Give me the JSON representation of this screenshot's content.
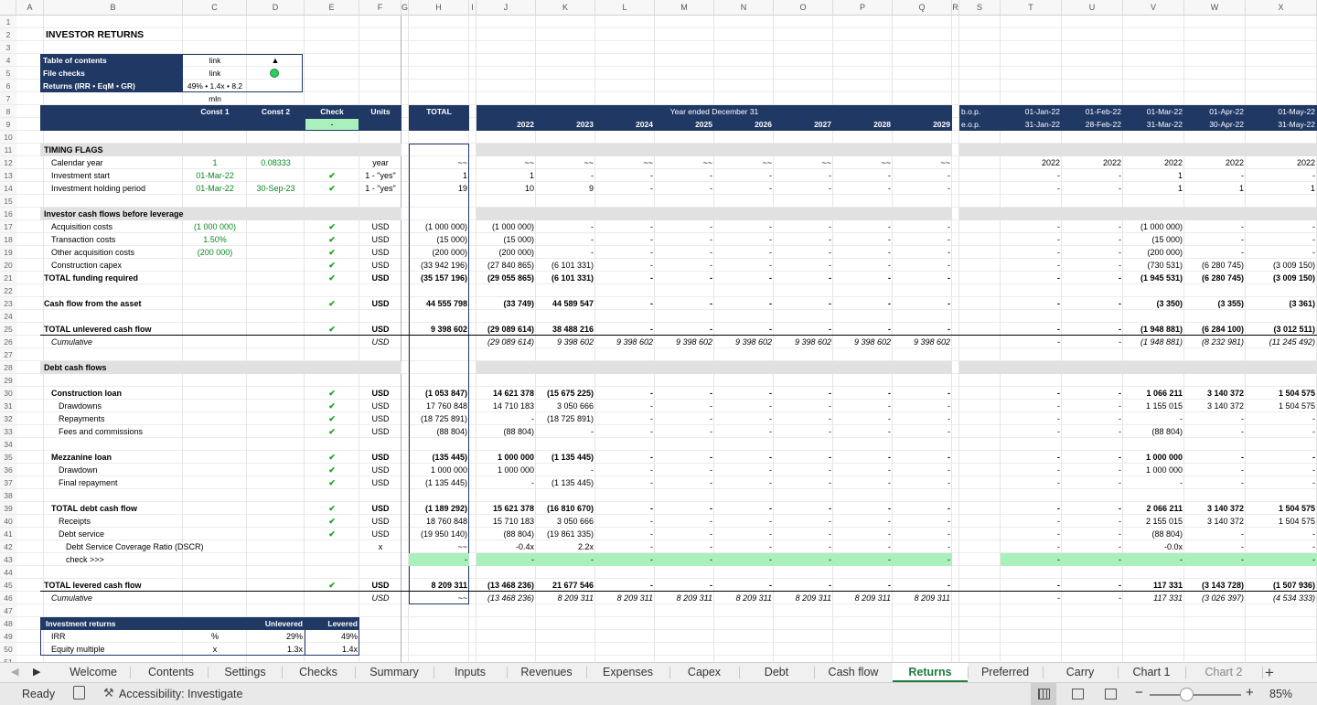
{
  "columns": [
    "A",
    "B",
    "C",
    "D",
    "E",
    "F",
    "G",
    "H",
    "I",
    "J",
    "K",
    "L",
    "M",
    "N",
    "O",
    "P",
    "Q",
    "R",
    "S",
    "T",
    "U",
    "V",
    "W",
    "X"
  ],
  "title": "INVESTOR RETURNS",
  "toc": {
    "r1": "Table of contents",
    "r1v": "link",
    "r1i": "▲",
    "r2": "File checks",
    "r2v": "link",
    "r3": "Returns (IRR • EqM • GR)",
    "r3v": "49% • 1.4x • 8.2 mln"
  },
  "header": {
    "const1": "Const 1",
    "const2": "Const 2",
    "check": "Check",
    "units": "Units",
    "total": "TOTAL",
    "check_val": "-",
    "year_ended": "Year ended December 31",
    "years": [
      "2022",
      "2023",
      "2024",
      "2025",
      "2026",
      "2027",
      "2028",
      "2029"
    ],
    "bop": "b.o.p.",
    "eop": "e.o.p.",
    "bop_dates": [
      "01-Jan-22",
      "01-Feb-22",
      "01-Mar-22",
      "01-Apr-22",
      "01-May-22"
    ],
    "eop_dates": [
      "31-Jan-22",
      "28-Feb-22",
      "31-Mar-22",
      "30-Apr-22",
      "31-May-22"
    ]
  },
  "rows": [
    {
      "r": 11,
      "b": "TIMING FLAGS",
      "bold": true,
      "band": true
    },
    {
      "r": 12,
      "b": "Calendar year",
      "ind": 1,
      "c": "1",
      "d": "0.08333",
      "f": "year",
      "h": "~~",
      "y": [
        "~~",
        "~~",
        "~~",
        "~~",
        "~~",
        "~~",
        "~~",
        "~~"
      ],
      "m": [
        "2022",
        "2022",
        "2022",
        "2022",
        "2022"
      ]
    },
    {
      "r": 13,
      "b": "Investment start",
      "ind": 1,
      "c": "01-Mar-22",
      "e": "✔",
      "f": "1 - \"yes\"",
      "h": "1",
      "y": [
        "1",
        "-",
        "-",
        "-",
        "-",
        "-",
        "-",
        "-"
      ],
      "m": [
        "-",
        "-",
        "1",
        "-",
        "-"
      ]
    },
    {
      "r": 14,
      "b": "Investment holding period",
      "ind": 1,
      "c": "01-Mar-22",
      "d": "30-Sep-23",
      "e": "✔",
      "f": "1 - \"yes\"",
      "h": "19",
      "y": [
        "10",
        "9",
        "-",
        "-",
        "-",
        "-",
        "-",
        "-"
      ],
      "m": [
        "-",
        "-",
        "1",
        "1",
        "1"
      ]
    },
    {
      "r": 16,
      "b": "Investor cash flows before leverage",
      "bold": true,
      "band": true
    },
    {
      "r": 17,
      "b": "Acquisition costs",
      "ind": 1,
      "c": "(1 000 000)",
      "e": "✔",
      "f": "USD",
      "h": "(1 000 000)",
      "y": [
        "(1 000 000)",
        "-",
        "-",
        "-",
        "-",
        "-",
        "-",
        "-"
      ],
      "m": [
        "-",
        "-",
        "(1 000 000)",
        "-",
        "-"
      ]
    },
    {
      "r": 18,
      "b": "Transaction costs",
      "ind": 1,
      "c": "1.50%",
      "e": "✔",
      "f": "USD",
      "h": "(15 000)",
      "y": [
        "(15 000)",
        "-",
        "-",
        "-",
        "-",
        "-",
        "-",
        "-"
      ],
      "m": [
        "-",
        "-",
        "(15 000)",
        "-",
        "-"
      ]
    },
    {
      "r": 19,
      "b": "Other acquisition costs",
      "ind": 1,
      "c": "(200 000)",
      "e": "✔",
      "f": "USD",
      "h": "(200 000)",
      "y": [
        "(200 000)",
        "-",
        "-",
        "-",
        "-",
        "-",
        "-",
        "-"
      ],
      "m": [
        "-",
        "-",
        "(200 000)",
        "-",
        "-"
      ]
    },
    {
      "r": 20,
      "b": "Construction capex",
      "ind": 1,
      "e": "✔",
      "f": "USD",
      "h": "(33 942 196)",
      "y": [
        "(27 840 865)",
        "(6 101 331)",
        "-",
        "-",
        "-",
        "-",
        "-",
        "-"
      ],
      "m": [
        "-",
        "-",
        "(730 531)",
        "(6 280 745)",
        "(3 009 150)"
      ]
    },
    {
      "r": 21,
      "b": "TOTAL funding required",
      "bold": true,
      "e": "✔",
      "f": "USD",
      "h": "(35 157 196)",
      "y": [
        "(29 055 865)",
        "(6 101 331)",
        "-",
        "-",
        "-",
        "-",
        "-",
        "-"
      ],
      "m": [
        "-",
        "-",
        "(1 945 531)",
        "(6 280 745)",
        "(3 009 150)"
      ]
    },
    {
      "r": 23,
      "b": "Cash flow from the asset",
      "bold": true,
      "e": "✔",
      "f": "USD",
      "h": "44 555 798",
      "y": [
        "(33 749)",
        "44 589 547",
        "-",
        "-",
        "-",
        "-",
        "-",
        "-"
      ],
      "m": [
        "-",
        "-",
        "(3 350)",
        "(3 355)",
        "(3 361)"
      ]
    },
    {
      "r": 25,
      "b": "TOTAL unlevered cash flow",
      "bold": true,
      "e": "✔",
      "f": "USD",
      "h": "9 398 602",
      "y": [
        "(29 089 614)",
        "38 488 216",
        "-",
        "-",
        "-",
        "-",
        "-",
        "-"
      ],
      "m": [
        "-",
        "-",
        "(1 948 881)",
        "(6 284 100)",
        "(3 012 511)"
      ],
      "topline": true
    },
    {
      "r": 26,
      "b": "Cumulative",
      "ital": true,
      "ind": 1,
      "f": "USD",
      "h": "",
      "y": [
        "(29 089 614)",
        "9 398 602",
        "9 398 602",
        "9 398 602",
        "9 398 602",
        "9 398 602",
        "9 398 602",
        "9 398 602"
      ],
      "m": [
        "-",
        "-",
        "(1 948 881)",
        "(8 232 981)",
        "(11 245 492)"
      ]
    },
    {
      "r": 28,
      "b": "Debt cash flows",
      "bold": true,
      "band": true
    },
    {
      "r": 30,
      "b": "Construction loan",
      "bold": true,
      "ind": 1,
      "e": "✔",
      "f": "USD",
      "h": "(1 053 847)",
      "y": [
        "14 621 378",
        "(15 675 225)",
        "-",
        "-",
        "-",
        "-",
        "-",
        "-"
      ],
      "m": [
        "-",
        "-",
        "1 066 211",
        "3 140 372",
        "1 504 575"
      ]
    },
    {
      "r": 31,
      "b": "Drawdowns",
      "ind": 2,
      "e": "✔",
      "f": "USD",
      "h": "17 760 848",
      "y": [
        "14 710 183",
        "3 050 666",
        "-",
        "-",
        "-",
        "-",
        "-",
        "-"
      ],
      "m": [
        "-",
        "-",
        "1 155 015",
        "3 140 372",
        "1 504 575"
      ]
    },
    {
      "r": 32,
      "b": "Repayments",
      "ind": 2,
      "e": "✔",
      "f": "USD",
      "h": "(18 725 891)",
      "y": [
        "-",
        "(18 725 891)",
        "-",
        "-",
        "-",
        "-",
        "-",
        "-"
      ],
      "m": [
        "-",
        "-",
        "-",
        "-",
        "-"
      ]
    },
    {
      "r": 33,
      "b": "Fees and commissions",
      "ind": 2,
      "e": "✔",
      "f": "USD",
      "h": "(88 804)",
      "y": [
        "(88 804)",
        "-",
        "-",
        "-",
        "-",
        "-",
        "-",
        "-"
      ],
      "m": [
        "-",
        "-",
        "(88 804)",
        "-",
        "-"
      ]
    },
    {
      "r": 35,
      "b": "Mezzanine loan",
      "bold": true,
      "ind": 1,
      "e": "✔",
      "f": "USD",
      "h": "(135 445)",
      "y": [
        "1 000 000",
        "(1 135 445)",
        "-",
        "-",
        "-",
        "-",
        "-",
        "-"
      ],
      "m": [
        "-",
        "-",
        "1 000 000",
        "-",
        "-"
      ]
    },
    {
      "r": 36,
      "b": "Drawdown",
      "ind": 2,
      "e": "✔",
      "f": "USD",
      "h": "1 000 000",
      "y": [
        "1 000 000",
        "-",
        "-",
        "-",
        "-",
        "-",
        "-",
        "-"
      ],
      "m": [
        "-",
        "-",
        "1 000 000",
        "-",
        "-"
      ]
    },
    {
      "r": 37,
      "b": "Final repayment",
      "ind": 2,
      "e": "✔",
      "f": "USD",
      "h": "(1 135 445)",
      "y": [
        "-",
        "(1 135 445)",
        "-",
        "-",
        "-",
        "-",
        "-",
        "-"
      ],
      "m": [
        "-",
        "-",
        "-",
        "-",
        "-"
      ]
    },
    {
      "r": 39,
      "b": "TOTAL debt cash flow",
      "bold": true,
      "ind": 1,
      "e": "✔",
      "f": "USD",
      "h": "(1 189 292)",
      "y": [
        "15 621 378",
        "(16 810 670)",
        "-",
        "-",
        "-",
        "-",
        "-",
        "-"
      ],
      "m": [
        "-",
        "-",
        "2 066 211",
        "3 140 372",
        "1 504 575"
      ]
    },
    {
      "r": 40,
      "b": "Receipts",
      "ind": 2,
      "e": "✔",
      "f": "USD",
      "h": "18 760 848",
      "y": [
        "15 710 183",
        "3 050 666",
        "-",
        "-",
        "-",
        "-",
        "-",
        "-"
      ],
      "m": [
        "-",
        "-",
        "2 155 015",
        "3 140 372",
        "1 504 575"
      ]
    },
    {
      "r": 41,
      "b": "Debt service",
      "ind": 2,
      "e": "✔",
      "f": "USD",
      "h": "(19 950 140)",
      "y": [
        "(88 804)",
        "(19 861 335)",
        "-",
        "-",
        "-",
        "-",
        "-",
        "-"
      ],
      "m": [
        "-",
        "-",
        "(88 804)",
        "-",
        "-"
      ]
    },
    {
      "r": 42,
      "b": "Debt Service Coverage Ratio (DSCR)",
      "ind": 3,
      "f": "x",
      "h": "~~",
      "y": [
        "-0.4x",
        "2.2x",
        "-",
        "-",
        "-",
        "-",
        "-",
        "-"
      ],
      "m": [
        "-",
        "-",
        "-0.0x",
        "-",
        "-"
      ]
    },
    {
      "r": 43,
      "b": "check >>>",
      "ind": 3,
      "h": "-",
      "y": [
        "-",
        "-",
        "-",
        "-",
        "-",
        "-",
        "-",
        "-"
      ],
      "m": [
        "-",
        "-",
        "-",
        "-",
        "-"
      ],
      "greenband": true
    },
    {
      "r": 45,
      "b": "TOTAL levered cash flow",
      "bold": true,
      "e": "✔",
      "f": "USD",
      "h": "8 209 311",
      "y": [
        "(13 468 236)",
        "21 677 546",
        "-",
        "-",
        "-",
        "-",
        "-",
        "-"
      ],
      "m": [
        "-",
        "-",
        "117 331",
        "(3 143 728)",
        "(1 507 936)"
      ],
      "topline": true
    },
    {
      "r": 46,
      "b": "Cumulative",
      "ital": true,
      "ind": 1,
      "f": "USD",
      "h": "~~",
      "y": [
        "(13 468 236)",
        "8 209 311",
        "8 209 311",
        "8 209 311",
        "8 209 311",
        "8 209 311",
        "8 209 311",
        "8 209 311"
      ],
      "m": [
        "-",
        "-",
        "117 331",
        "(3 026 397)",
        "(4 534 333)"
      ]
    }
  ],
  "returns": {
    "title": "Investment returns",
    "unlev": "Unlevered",
    "lev": "Levered",
    "irr": "IRR",
    "irr_u": "%",
    "irr_uv": "29%",
    "irr_lv": "49%",
    "eqm": "Equity multiple",
    "eqm_u": "x",
    "eqm_uv": "1.3x",
    "eqm_lv": "1.4x"
  },
  "tabs": [
    "Welcome",
    "Contents",
    "Settings",
    "Checks",
    "Summary",
    "Inputs",
    "Revenues",
    "Expenses",
    "Capex",
    "Debt",
    "Cash flow",
    "Returns",
    "Preferred",
    "Carry",
    "Chart 1",
    "Chart 2"
  ],
  "active_tab": "Returns",
  "status": {
    "ready": "Ready",
    "accessibility": "Accessibility: Investigate",
    "zoom": "85%"
  },
  "colors": {
    "navy": "#1f3864",
    "green_band": "#a9f0bd",
    "grey_band": "#e1e1e1",
    "active_tab": "#1e7b3d"
  }
}
